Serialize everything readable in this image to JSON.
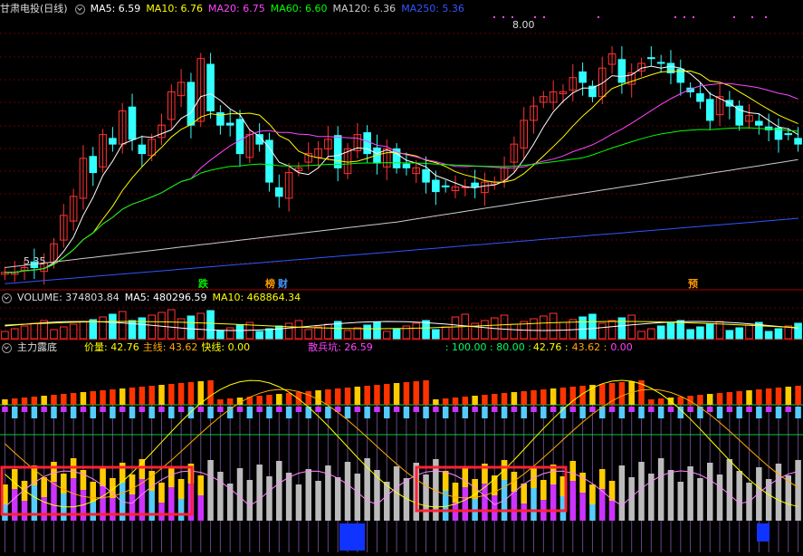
{
  "stock": {
    "name": "甘肃电投(日线)"
  },
  "price_header": {
    "items": [
      {
        "label": "MA5: 6.59",
        "color": "#ffffff"
      },
      {
        "label": "MA10: 6.76",
        "color": "#ffff00"
      },
      {
        "label": "MA20: 6.75",
        "color": "#ff44ff"
      },
      {
        "label": "MA60: 6.60",
        "color": "#00ff00"
      },
      {
        "label": "MA120: 6.36",
        "color": "#cccccc"
      },
      {
        "label": "MA250: 5.36",
        "color": "#3355ff"
      }
    ]
  },
  "volume_header": {
    "title": "VOLUME: 374803.84",
    "items": [
      {
        "label": "MA5: 480296.59",
        "color": "#ffffff"
      },
      {
        "label": "MA10: 468864.34",
        "color": "#ffff00"
      }
    ]
  },
  "indicator_header": {
    "title": "主力露底",
    "items": [
      {
        "label": "价量: 42.76",
        "color": "#ffff00"
      },
      {
        "label": "主线: 43.62",
        "color": "#ffaa00"
      },
      {
        "label": "快线: 0.00",
        "color": "#ffff00"
      },
      {
        "label": "散兵坑: 26.59",
        "color": "#ff44ff"
      }
    ],
    "ref_levels": ": 100.00 : 80.00 :",
    "ref_values": [
      {
        "label": "42.76",
        "color": "#ffff00"
      },
      {
        "label": "43.62",
        "color": "#ffaa00"
      },
      {
        "label": "0.00",
        "color": "#ff44ff"
      }
    ]
  },
  "annotations": {
    "high_label": "8.00",
    "low_label": "5.35",
    "tags": [
      {
        "text": "跌",
        "color": "#00ee00"
      },
      {
        "text": "榜",
        "color": "#ff9900"
      },
      {
        "text": "财",
        "color": "#4499ff"
      },
      {
        "text": "预",
        "color": "#ff9900"
      }
    ]
  },
  "colors": {
    "up": "#ff3333",
    "down": "#33ffff",
    "grid": "#660000",
    "frame": "#aa0000",
    "highlight_box": "#ff2233"
  },
  "chart_data": {
    "type": "candlestick",
    "bars": 82,
    "ylim": [
      5.35,
      8.0
    ],
    "price_high": 8.0,
    "price_low": 5.35,
    "last_ma": {
      "MA5": 6.59,
      "MA10": 6.76,
      "MA20": 6.75,
      "MA60": 6.6,
      "MA120": 6.36,
      "MA250": 5.36
    },
    "closes": [
      5.4,
      5.4,
      5.45,
      5.45,
      5.5,
      5.7,
      6.0,
      6.2,
      6.6,
      6.45,
      6.85,
      6.75,
      7.1,
      6.8,
      6.65,
      6.8,
      6.95,
      7.3,
      7.4,
      6.95,
      7.65,
      7.1,
      6.95,
      6.95,
      6.65,
      6.85,
      6.75,
      6.35,
      6.2,
      6.45,
      6.5,
      6.65,
      6.7,
      6.8,
      6.5,
      6.7,
      6.85,
      6.65,
      6.55,
      6.7,
      6.5,
      6.5,
      6.5,
      6.35,
      6.25,
      6.3,
      6.3,
      6.3,
      6.3,
      6.35,
      6.35,
      6.5,
      6.75,
      7.0,
      7.15,
      7.25,
      7.3,
      7.3,
      7.45,
      7.4,
      7.25,
      7.55,
      7.7,
      7.4,
      7.5,
      7.6,
      7.65,
      7.6,
      7.5,
      7.4,
      7.3,
      7.2,
      7.0,
      7.25,
      7.15,
      6.95,
      7.05,
      6.95,
      6.9,
      6.8,
      6.85,
      6.75
    ],
    "volume": {
      "last": 374803.84,
      "ma5": 480296.59,
      "ma10": 468864.34
    },
    "indicator": {
      "jialiang": 42.76,
      "zhuxian": 43.62,
      "kuaixian": 0.0,
      "sanbingkeng": 26.59,
      "levels": [
        100.0,
        80.0
      ]
    }
  }
}
